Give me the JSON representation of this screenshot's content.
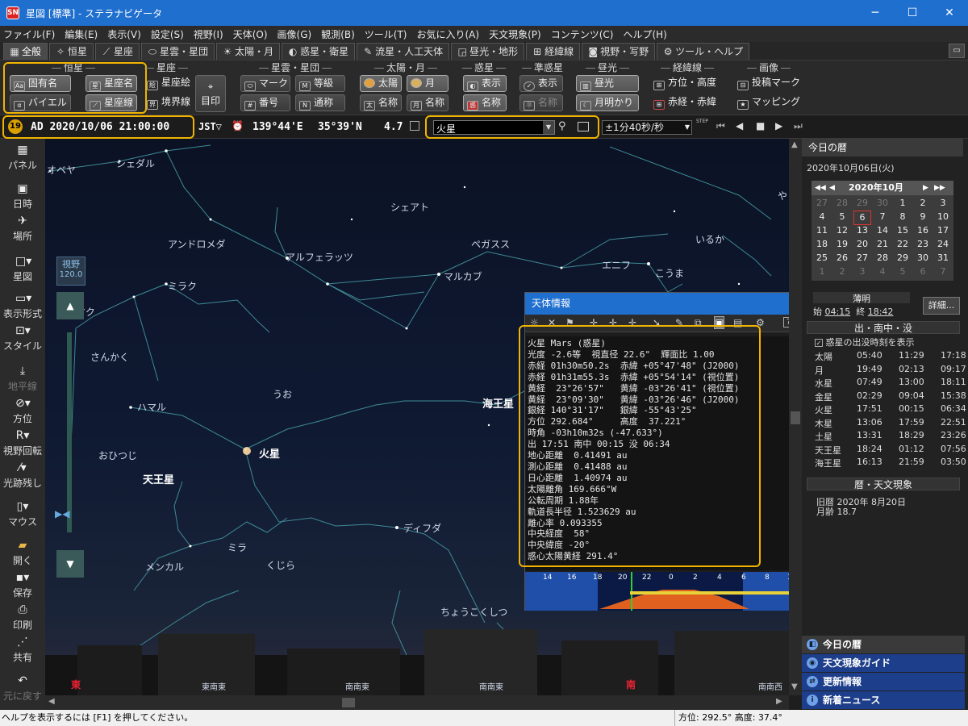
{
  "window": {
    "title": "星図 [標準] - ステラナビゲータ",
    "min": "─",
    "max": "☐",
    "close": "✕"
  },
  "menu": [
    "ファイル(F)",
    "編集(E)",
    "表示(V)",
    "設定(S)",
    "視野(I)",
    "天体(O)",
    "画像(G)",
    "観測(B)",
    "ツール(T)",
    "お気に入り(A)",
    "天文現象(P)",
    "コンテンツ(C)",
    "ヘルプ(H)"
  ],
  "tabs": [
    {
      "label": "全般",
      "icon": "grid-icon"
    },
    {
      "label": "恒星",
      "icon": "star-icon"
    },
    {
      "label": "星座",
      "icon": "constellation-icon"
    },
    {
      "label": "星雲・星団",
      "icon": "nebula-icon"
    },
    {
      "label": "太陽・月",
      "icon": "sun-icon"
    },
    {
      "label": "惑星・衛星",
      "icon": "planet-icon"
    },
    {
      "label": "流星・人工天体",
      "icon": "meteor-icon"
    },
    {
      "label": "昼光・地形",
      "icon": "landscape-icon"
    },
    {
      "label": "経緯線",
      "icon": "grid-lines-icon"
    },
    {
      "label": "視野・写野",
      "icon": "camera-icon"
    },
    {
      "label": "ツール・ヘルプ",
      "icon": "gear-icon"
    }
  ],
  "pin": "▭",
  "toolbar": {
    "groups": {
      "star": "恒星",
      "constellation": "星座",
      "nebula": "星雲・星団",
      "sunmoon": "太陽・月",
      "planet": "惑星",
      "minor": "準惑星",
      "daylight": "昼光",
      "grid": "経緯線",
      "image": "画像"
    },
    "buttons": {
      "proper_name": "固有名",
      "bayer": "バイエル",
      "const_name": "星座名",
      "const_line": "星座線",
      "const_pic": "星座絵",
      "boundary": "境界線",
      "mark_label": "目印",
      "neb_mark": "マーク",
      "neb_mag": "等級",
      "neb_num": "番号",
      "neb_common": "通称",
      "sun": "太陽",
      "moon": "月",
      "sun_name": "名称",
      "moon_name": "名称",
      "planet_show": "表示",
      "planet_name": "名称",
      "minor_show": "表示",
      "minor_name": "名称",
      "daylight": "昼光",
      "moonlight": "月明かり",
      "altaz": "方位・高度",
      "radec": "赤経・赤緯",
      "post_mark": "投稿マーク",
      "mapping": "マッピング"
    }
  },
  "statusline": {
    "badge": "19",
    "datetime": "AD 2020/10/06 21:00:00",
    "tz": "JST▽",
    "lon": "139°44'E",
    "lat": "35°39'N",
    "mag": "4.7",
    "search_value": "火星",
    "speed": "±1分40秒/秒",
    "step_label": "STEP"
  },
  "left": [
    {
      "label": "パネル",
      "icon": "panel-icon",
      "dim": false
    },
    {
      "label": "日時",
      "icon": "calendar-icon",
      "dim": false
    },
    {
      "label": "場所",
      "icon": "location-icon",
      "dim": false
    },
    {
      "label": "星図",
      "icon": "starmap-icon",
      "dim": false
    },
    {
      "label": "表示形式",
      "icon": "display-icon",
      "dim": false
    },
    {
      "label": "スタイル",
      "icon": "style-icon",
      "dim": false
    },
    {
      "label": "地平線",
      "icon": "horizon-icon",
      "dim": true
    },
    {
      "label": "方位",
      "icon": "compass-icon",
      "dim": false
    },
    {
      "label": "視野回転",
      "icon": "rotate-icon",
      "dim": false
    },
    {
      "label": "光跡残し",
      "icon": "trail-icon",
      "dim": false
    },
    {
      "label": "マウス",
      "icon": "mouse-icon",
      "dim": false
    },
    {
      "label": "開く",
      "icon": "folder-icon",
      "dim": false
    },
    {
      "label": "保存",
      "icon": "save-icon",
      "dim": false
    },
    {
      "label": "印刷",
      "icon": "print-icon",
      "dim": false
    },
    {
      "label": "共有",
      "icon": "share-icon",
      "dim": false
    },
    {
      "label": "元に戻す",
      "icon": "undo-icon",
      "dim": true
    }
  ],
  "fov": {
    "label": "視野",
    "value": "120.0"
  },
  "sky": {
    "labels": [
      {
        "t": "オベヤ",
        "b": false
      },
      {
        "t": "シェダル",
        "b": false
      },
      {
        "t": "シェアト",
        "b": false
      },
      {
        "t": "アンドロメダ",
        "b": false
      },
      {
        "t": "アルフェラッツ",
        "b": false
      },
      {
        "t": "ペガスス",
        "b": false
      },
      {
        "t": "いるか",
        "b": false
      },
      {
        "t": "ミラク",
        "b": false
      },
      {
        "t": "マルカブ",
        "b": false
      },
      {
        "t": "エニフ",
        "b": false
      },
      {
        "t": "こうま",
        "b": false
      },
      {
        "t": "アルマク",
        "b": false
      },
      {
        "t": "さんかく",
        "b": false
      },
      {
        "t": "うお",
        "b": false
      },
      {
        "t": "ハマル",
        "b": false
      },
      {
        "t": "海王星",
        "b": true
      },
      {
        "t": "火星",
        "b": true
      },
      {
        "t": "おひつじ",
        "b": false
      },
      {
        "t": "天王星",
        "b": true
      },
      {
        "t": "ディフダ",
        "b": false
      },
      {
        "t": "ミラ",
        "b": false
      },
      {
        "t": "メンカル",
        "b": false
      },
      {
        "t": "くじら",
        "b": false
      },
      {
        "t": "ちょうこくしつ",
        "b": false
      },
      {
        "t": "や",
        "b": false
      }
    ],
    "horizon": [
      "東",
      "東南東",
      "南南東",
      "南南東",
      "南",
      "南南西"
    ]
  },
  "dialog": {
    "title": "天体情報",
    "close": "x",
    "lines": [
      "火星 Mars (惑星)",
      "光度 -2.6等  視直径 22.6\"  輝面比 1.00",
      "赤経 01h30m50.2s  赤緯 +05°47'48\" (J2000)",
      "赤経 01h31m55.3s  赤緯 +05°54'14\" (視位置)",
      "黄経  23°26'57\"   黄緯 -03°26'41\" (視位置)",
      "黄経  23°09'30\"   黄緯 -03°26'46\" (J2000)",
      "銀経 140°31'17\"   銀緯 -55°43'25\"",
      "方位 292.684°     高度  37.221°",
      "時角 -03h10m32s (-47.633°)",
      "出 17:51 南中 00:15 没 06:34",
      "地心距離  0.41491 au",
      "測心距離  0.41488 au",
      "日心距離  1.40974 au",
      "太陽離角 169.666°W",
      "公転周期 1.88年",
      "軌道長半径 1.523629 au",
      "離心率 0.093355",
      "中央経度  58°",
      "中央緯度 -20°",
      "惑心太陽黄経 291.4°"
    ],
    "timeline": [
      "14",
      "16",
      "18",
      "20",
      "22",
      "0",
      "2",
      "4",
      "6",
      "8",
      "10"
    ]
  },
  "right": {
    "title": "今日の暦",
    "date": "2020年10月06日(火)",
    "cal": {
      "nav_prev2": "◀◀",
      "nav_prev": "◀",
      "month": "2020年10月",
      "nav_next": "▶",
      "nav_next2": "▶▶",
      "weeks": [
        [
          "27",
          "28",
          "29",
          "30",
          "1",
          "2",
          "3"
        ],
        [
          "4",
          "5",
          "6",
          "7",
          "8",
          "9",
          "10"
        ],
        [
          "11",
          "12",
          "13",
          "14",
          "15",
          "16",
          "17"
        ],
        [
          "18",
          "19",
          "20",
          "21",
          "22",
          "23",
          "24"
        ],
        [
          "25",
          "26",
          "27",
          "28",
          "29",
          "30",
          "31"
        ],
        [
          "1",
          "2",
          "3",
          "4",
          "5",
          "6",
          "7"
        ]
      ]
    },
    "twilight": {
      "title": "薄明",
      "start_lbl": "始",
      "start": "04:15",
      "end_lbl": "終",
      "end": "18:42"
    },
    "detail_btn": "詳細...",
    "rise_section": "出・南中・没",
    "show_planets": "惑星の出没時刻を表示",
    "rise": [
      [
        "太陽",
        "05:40",
        "11:29",
        "17:18"
      ],
      [
        "月",
        "19:49",
        "02:13",
        "09:17"
      ],
      [
        "水星",
        "07:49",
        "13:00",
        "18:11"
      ],
      [
        "金星",
        "02:29",
        "09:04",
        "15:38"
      ],
      [
        "火星",
        "17:51",
        "00:15",
        "06:34"
      ],
      [
        "木星",
        "13:06",
        "17:59",
        "22:51"
      ],
      [
        "土星",
        "13:31",
        "18:29",
        "23:26"
      ],
      [
        "天王星",
        "18:24",
        "01:12",
        "07:56"
      ],
      [
        "海王星",
        "16:13",
        "21:59",
        "03:50"
      ]
    ],
    "events_section": "暦・天文現象",
    "old_cal": "旧暦  2020年 8月20日",
    "moon_age": "月齢 18.7",
    "bottom_tabs": [
      "今日の暦",
      "天文現象ガイド",
      "更新情報",
      "新着ニュース"
    ]
  },
  "status": {
    "help": "ヘルプを表示するには [F1] を押してください。",
    "azalt": "方位: 292.5° 高度:  37.4°"
  }
}
